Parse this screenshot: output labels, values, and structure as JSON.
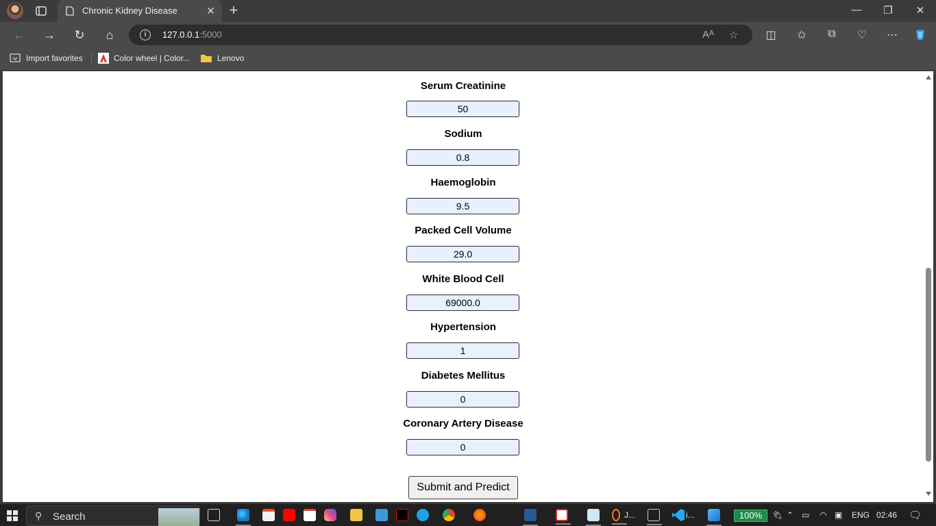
{
  "browser": {
    "tab_title": "Chronic Kidney Disease",
    "url_host": "127.0.0.1",
    "url_port": ":5000",
    "favorites": [
      {
        "label": "Import favorites"
      },
      {
        "label": "Color wheel | Color..."
      },
      {
        "label": "Lenovo"
      }
    ]
  },
  "form": {
    "fields": [
      {
        "label": "Serum Creatinine",
        "value": "50"
      },
      {
        "label": "Sodium",
        "value": "0.8"
      },
      {
        "label": "Haemoglobin",
        "value": "9.5"
      },
      {
        "label": "Packed Cell Volume",
        "value": "29.0"
      },
      {
        "label": "White Blood Cell",
        "value": "69000.0"
      },
      {
        "label": "Hypertension",
        "value": "1"
      },
      {
        "label": "Diabetes Mellitus",
        "value": "0"
      },
      {
        "label": "Coronary Artery Disease",
        "value": "0"
      }
    ],
    "submit_label": "Submit and Predict"
  },
  "taskbar": {
    "search_label": "Search",
    "app_label_j": "J...",
    "app_label_i": "i...",
    "battery_percent": "100%",
    "language": "ENG",
    "time": "02:46"
  },
  "colors": {
    "input_background": "#e8f0fe",
    "zoom_badge": "#1f8a4c"
  }
}
